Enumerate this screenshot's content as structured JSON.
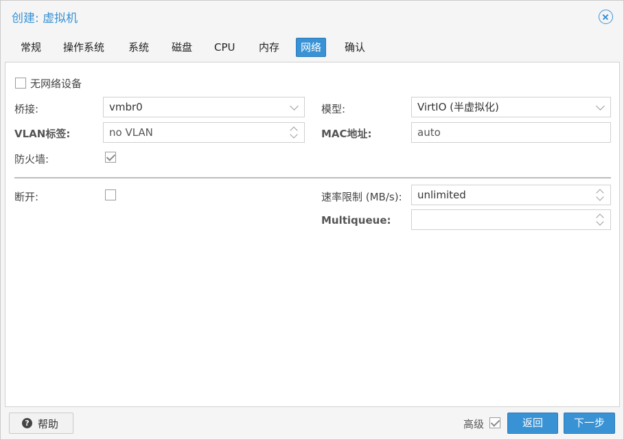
{
  "dialog": {
    "title": "创建: 虚拟机"
  },
  "tabs": [
    {
      "label": "常规"
    },
    {
      "label": "操作系统"
    },
    {
      "label": "系统"
    },
    {
      "label": "磁盘"
    },
    {
      "label": "CPU"
    },
    {
      "label": "内存"
    },
    {
      "label": "网络",
      "active": true
    },
    {
      "label": "确认"
    }
  ],
  "form": {
    "no_network_label": "无网络设备",
    "no_network_checked": false,
    "bridge_label": "桥接:",
    "bridge_value": "vmbr0",
    "vlan_label": "VLAN标签:",
    "vlan_value": "no VLAN",
    "firewall_label": "防火墙:",
    "firewall_checked": true,
    "model_label": "模型:",
    "model_value": "VirtIO (半虚拟化)",
    "mac_label": "MAC地址:",
    "mac_value": "auto",
    "disconnect_label": "断开:",
    "disconnect_checked": false,
    "rate_label": "速率限制 (MB/s):",
    "rate_value": "unlimited",
    "multiqueue_label": "Multiqueue:",
    "multiqueue_value": ""
  },
  "footer": {
    "help_label": "帮助",
    "help_icon": "?",
    "advanced_label": "高级",
    "advanced_checked": true,
    "back_label": "返回",
    "next_label": "下一步"
  },
  "colors": {
    "accent": "#3892d4"
  }
}
